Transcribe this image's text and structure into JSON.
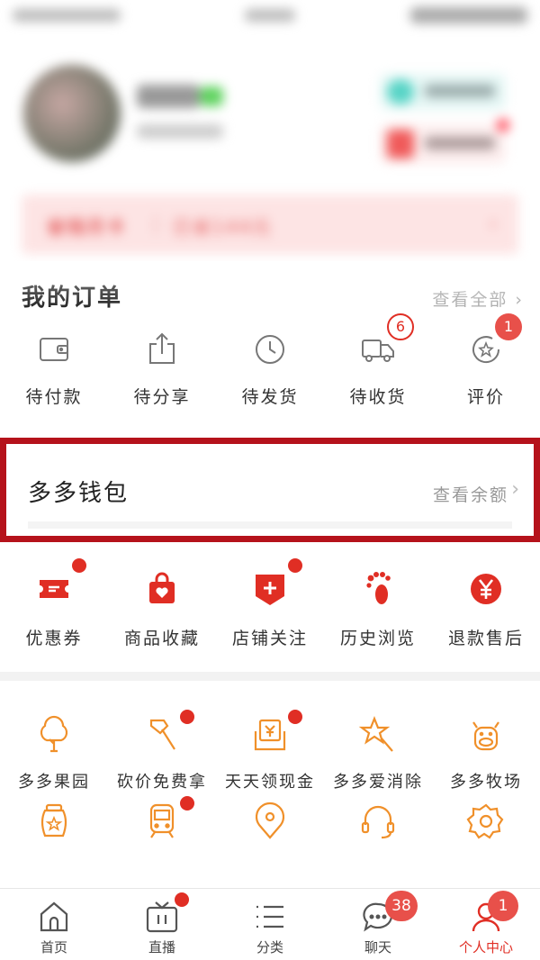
{
  "header": {
    "month_card_title": "省钱月卡",
    "month_card_separator": "|",
    "month_card_saved": "已省144元",
    "month_card_arrow": "›"
  },
  "orders": {
    "title": "我的订单",
    "view_all": "查看全部 ›",
    "items": [
      {
        "label": "待付款",
        "icon": "wallet-icon"
      },
      {
        "label": "待分享",
        "icon": "share-icon"
      },
      {
        "label": "待发货",
        "icon": "clock-icon"
      },
      {
        "label": "待收货",
        "icon": "truck-icon",
        "badge": "6"
      },
      {
        "label": "评价",
        "icon": "review-icon",
        "badge": "1"
      }
    ]
  },
  "wallet": {
    "title": "多多钱包",
    "link": "查看余额",
    "chevron": "›"
  },
  "services": [
    {
      "label": "优惠券",
      "icon": "coupon-icon",
      "dot": true
    },
    {
      "label": "商品收藏",
      "icon": "favorites-bag-icon",
      "dot": false
    },
    {
      "label": "店铺关注",
      "icon": "store-follow-icon",
      "dot": true
    },
    {
      "label": "历史浏览",
      "icon": "footprint-icon",
      "dot": false
    },
    {
      "label": "退款售后",
      "icon": "refund-yen-icon",
      "dot": false
    }
  ],
  "grid": [
    {
      "label": "多多果园",
      "icon": "tree-icon",
      "dot": false
    },
    {
      "label": "砍价免费拿",
      "icon": "axe-icon",
      "dot": true
    },
    {
      "label": "天天领现金",
      "icon": "cash-envelope-icon",
      "dot": true
    },
    {
      "label": "多多爱消除",
      "icon": "star-wand-icon",
      "dot": false
    },
    {
      "label": "多多牧场",
      "icon": "cow-icon",
      "dot": false
    },
    {
      "label": "",
      "icon": "honey-jar-icon",
      "dot": false
    },
    {
      "label": "",
      "icon": "train-icon",
      "dot": true
    },
    {
      "label": "",
      "icon": "location-pin-icon",
      "dot": false
    },
    {
      "label": "",
      "icon": "headset-icon",
      "dot": false
    },
    {
      "label": "",
      "icon": "settings-gear-icon",
      "dot": false
    }
  ],
  "tabbar": [
    {
      "label": "首页",
      "icon": "home-icon"
    },
    {
      "label": "直播",
      "icon": "live-tv-icon",
      "dot": true
    },
    {
      "label": "分类",
      "icon": "category-list-icon"
    },
    {
      "label": "聊天",
      "icon": "chat-bubble-icon",
      "badge": "38"
    },
    {
      "label": "个人中心",
      "icon": "profile-icon",
      "badge": "1",
      "active": true
    }
  ],
  "colors": {
    "brand_red": "#e02e24",
    "highlight_border": "#b5121b",
    "grid_orange": "#f0902a"
  }
}
